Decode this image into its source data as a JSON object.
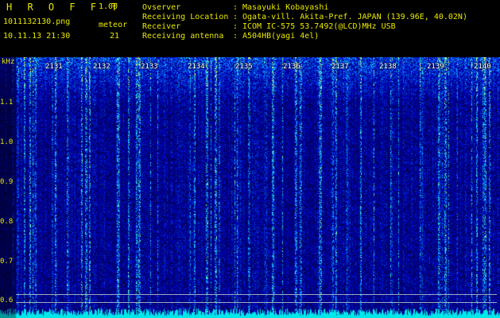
{
  "header": {
    "app_title": "H R O F F T",
    "version": "1.00",
    "file_name": "1011132130.png",
    "date_time": "10.11.13 21:30",
    "meteor_label": "meteor",
    "meteor_count": "21",
    "info": [
      {
        "key": "Ovserver",
        "sep": ":",
        "value": "Masayuki Kobayashi"
      },
      {
        "key": "Receiving Location",
        "sep": ":",
        "value": "Ogata-vill. Akita-Pref. JAPAN (139.96E, 40.02N)"
      },
      {
        "key": "Receiver",
        "sep": ":",
        "value": "ICOM IC-575 53.7492(@LCD)MHz USB"
      },
      {
        "key": "Receiving antenna",
        "sep": ":",
        "value": "A504HB(yagi 4el)"
      }
    ]
  },
  "plot": {
    "axis_unit": "kHz",
    "y_ticks": [
      "1.1",
      "1.0",
      "0.9",
      "0.8",
      "0.7",
      "0.6"
    ],
    "x_ticks": [
      "2131",
      "2132",
      "2133",
      "2134",
      "2135",
      "2136",
      "2137",
      "2138",
      "2139",
      "2140"
    ],
    "colors": {
      "background": "#000000",
      "label": "#e8e800",
      "tick": "#ffffff",
      "noise_floor": "#00e8e8"
    }
  }
}
